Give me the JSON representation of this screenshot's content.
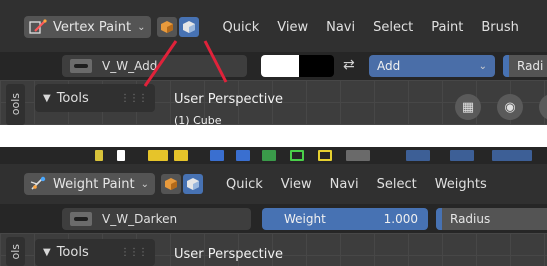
{
  "top": {
    "mode": {
      "label": "Vertex Paint",
      "icon": "vertex-paint-icon"
    },
    "menu": [
      "Quick",
      "View",
      "Navi",
      "Select",
      "Paint",
      "Brush"
    ],
    "brush_name": "V_W_Add",
    "color_primary": "#ffffff",
    "color_secondary": "#000000",
    "blend_mode": "Add",
    "radius_label": "Radi",
    "side_tab": "ools",
    "tools_label": "Tools",
    "view_label": "User Perspective",
    "view_sublabel": "(1) Cube",
    "annotation_color": "#e0223a"
  },
  "bottom": {
    "mode": {
      "label": "Weight Paint",
      "icon": "weight-paint-icon"
    },
    "menu": [
      "Quick",
      "View",
      "Navi",
      "Select",
      "Weights"
    ],
    "brush_name": "V_W_Darken",
    "weight_label": "Weight",
    "weight_value": "1.000",
    "radius_label": "Radius",
    "side_tab": "ols",
    "tools_label": "Tools",
    "view_label": "User Perspective"
  },
  "colors": {
    "accent": "#4772b3",
    "header_bg": "#303030",
    "toolbar_bg": "#262626"
  }
}
